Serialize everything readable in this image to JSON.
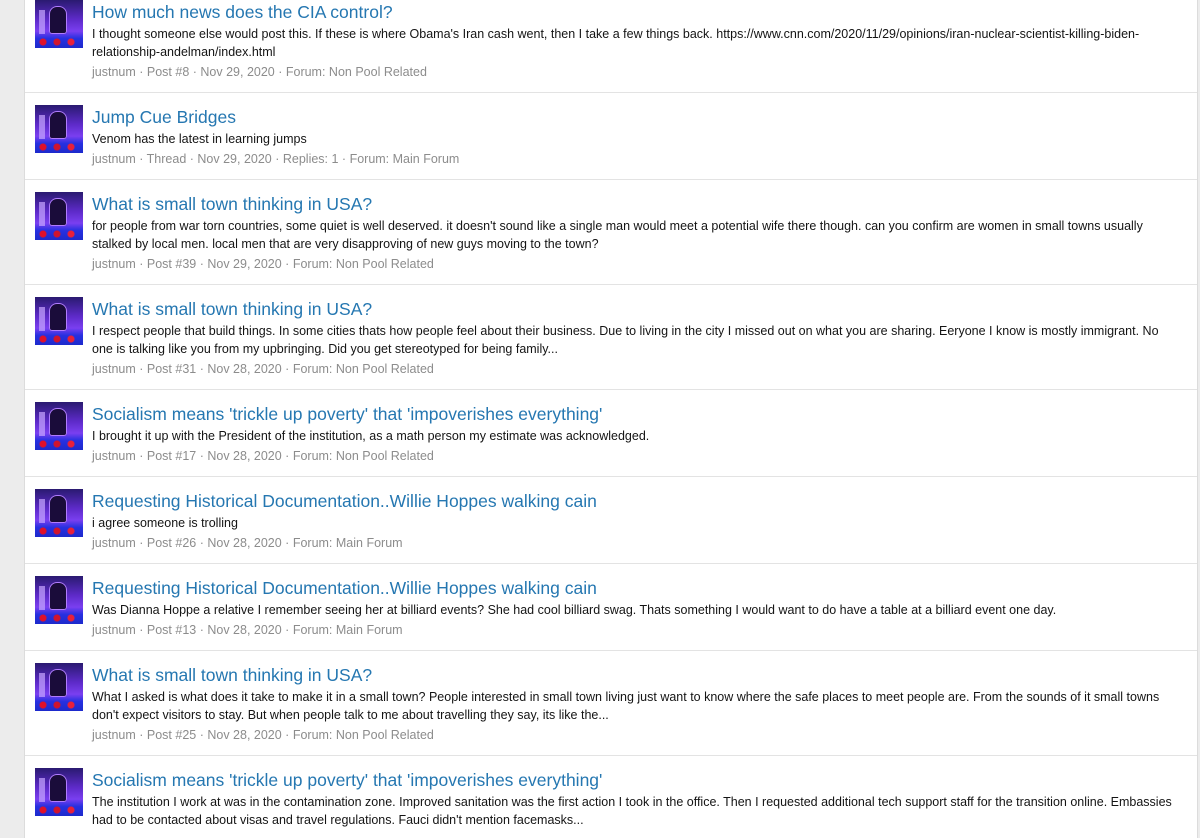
{
  "results": [
    {
      "title": "How much news does the CIA control?",
      "snippet": "I thought someone else would post this. If these is where Obama's Iran cash went, then I take a few things back. https://www.cnn.com/2020/11/29/opinions/iran-nuclear-scientist-killing-biden-relationship-andelman/index.html",
      "user": "justnum",
      "kind": "Post #8",
      "date": "Nov 29, 2020",
      "extra": "",
      "forum": "Forum: Non Pool Related"
    },
    {
      "title": "Jump Cue Bridges",
      "snippet": "Venom has the latest in learning jumps",
      "user": "justnum",
      "kind": "Thread",
      "date": "Nov 29, 2020",
      "extra": "Replies: 1",
      "forum": "Forum: Main Forum"
    },
    {
      "title": "What is small town thinking in USA?",
      "snippet": "for people from war torn countries, some quiet is well deserved. it doesn't sound like a single man would meet a potential wife there though. can you confirm are women in small towns usually stalked by local men. local men that are very disapproving of new guys moving to the town?",
      "user": "justnum",
      "kind": "Post #39",
      "date": "Nov 29, 2020",
      "extra": "",
      "forum": "Forum: Non Pool Related"
    },
    {
      "title": "What is small town thinking in USA?",
      "snippet": "I respect people that build things. In some cities thats how people feel about their business. Due to living in the city I missed out on what you are sharing. Eeryone I know is mostly immigrant. No one is talking like you from my upbringing. Did you get stereotyped for being family...",
      "user": "justnum",
      "kind": "Post #31",
      "date": "Nov 28, 2020",
      "extra": "",
      "forum": "Forum: Non Pool Related"
    },
    {
      "title": "Socialism means 'trickle up poverty' that 'impoverishes everything'",
      "snippet": "I brought it up with the President of the institution, as a math person my estimate was acknowledged.",
      "user": "justnum",
      "kind": "Post #17",
      "date": "Nov 28, 2020",
      "extra": "",
      "forum": "Forum: Non Pool Related"
    },
    {
      "title": "Requesting Historical Documentation..Willie Hoppes walking cain",
      "snippet": "i agree someone is trolling",
      "user": "justnum",
      "kind": "Post #26",
      "date": "Nov 28, 2020",
      "extra": "",
      "forum": "Forum: Main Forum"
    },
    {
      "title": "Requesting Historical Documentation..Willie Hoppes walking cain",
      "snippet": "Was Dianna Hoppe a relative I remember seeing her at billiard events? She had cool billiard swag. Thats something I would want to do have a table at a billiard event one day.",
      "user": "justnum",
      "kind": "Post #13",
      "date": "Nov 28, 2020",
      "extra": "",
      "forum": "Forum: Main Forum"
    },
    {
      "title": "What is small town thinking in USA?",
      "snippet": "What I asked is what does it take to make it in a small town? People interested in small town living just want to know where the safe places to meet people are. From the sounds of it small towns don't expect visitors to stay. But when people talk to me about travelling they say, its like the...",
      "user": "justnum",
      "kind": "Post #25",
      "date": "Nov 28, 2020",
      "extra": "",
      "forum": "Forum: Non Pool Related"
    },
    {
      "title": "Socialism means 'trickle up poverty' that 'impoverishes everything'",
      "snippet": "The institution I work at was in the contamination zone. Improved sanitation was the first action I took in the office. Then I requested additional tech support staff for the transition online. Embassies had to be contacted about visas and travel regulations. Fauci didn't mention facemasks...",
      "user": "",
      "kind": "",
      "date": "",
      "extra": "",
      "forum": ""
    }
  ],
  "separator": " · "
}
